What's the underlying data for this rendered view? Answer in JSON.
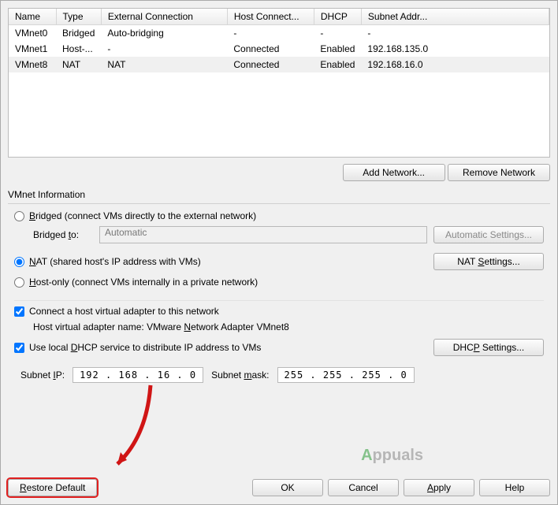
{
  "table": {
    "headers": {
      "name": "Name",
      "type": "Type",
      "ext": "External Connection",
      "host": "Host Connect...",
      "dhcp": "DHCP",
      "subnet": "Subnet Addr..."
    },
    "rows": [
      {
        "name": "VMnet0",
        "type": "Bridged",
        "ext": "Auto-bridging",
        "host": "-",
        "dhcp": "-",
        "subnet": "-"
      },
      {
        "name": "VMnet1",
        "type": "Host-...",
        "ext": "-",
        "host": "Connected",
        "dhcp": "Enabled",
        "subnet": "192.168.135.0"
      },
      {
        "name": "VMnet8",
        "type": "NAT",
        "ext": "NAT",
        "host": "Connected",
        "dhcp": "Enabled",
        "subnet": "192.168.16.0"
      }
    ]
  },
  "buttons": {
    "add_network": "Add Network...",
    "remove_network": "Remove Network",
    "automatic_settings": "Automatic Settings...",
    "nat_settings": "NAT Settings...",
    "dhcp_settings": "DHCP Settings...",
    "restore_default": "Restore Default",
    "ok": "OK",
    "cancel": "Cancel",
    "apply": "Apply",
    "help": "Help"
  },
  "info": {
    "legend": "VMnet Information",
    "bridged_label": "Bridged (connect VMs directly to the external network)",
    "bridged_to_label": "Bridged to:",
    "bridged_to_value": "Automatic",
    "nat_label": "NAT (shared host's IP address with VMs)",
    "hostonly_label": "Host-only (connect VMs internally in a private network)",
    "connect_adapter_label": "Connect a host virtual adapter to this network",
    "adapter_name_label": "Host virtual adapter name: VMware Network Adapter VMnet8",
    "dhcp_label": "Use local DHCP service to distribute IP address to VMs",
    "subnet_ip_label": "Subnet IP:",
    "subnet_ip_value": "192 . 168 . 16 . 0",
    "subnet_mask_label": "Subnet mask:",
    "subnet_mask_value": "255 . 255 . 255 . 0",
    "selected_mode": "nat",
    "connect_adapter_checked": true,
    "dhcp_checked": true
  },
  "watermark": {
    "a": "A",
    "rest": "ppuals"
  }
}
